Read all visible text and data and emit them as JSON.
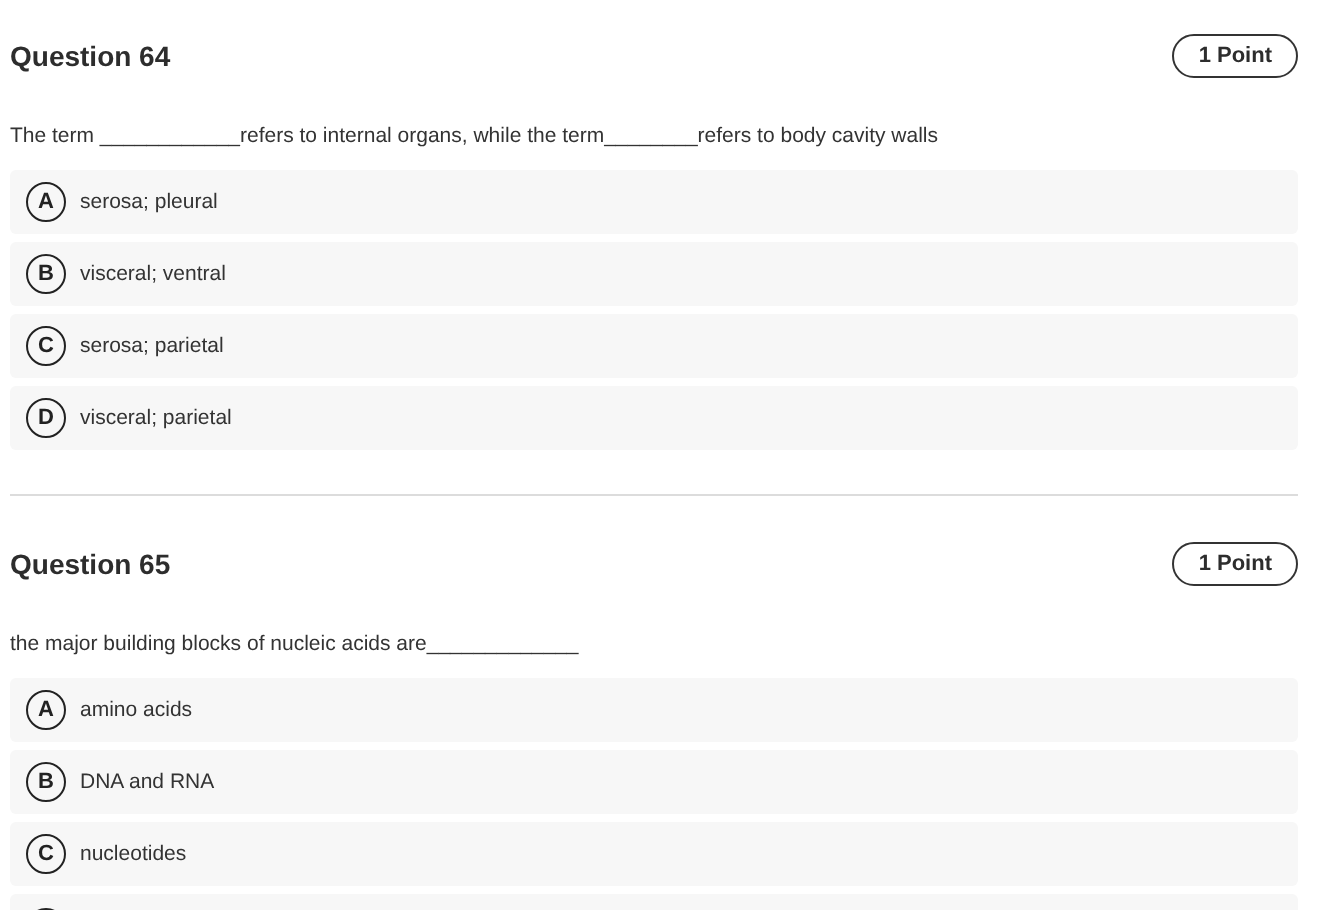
{
  "questions": [
    {
      "title": "Question 64",
      "points": "1 Point",
      "text": "The term ____________refers to internal organs, while the term________refers to body cavity walls",
      "options": [
        {
          "letter": "A",
          "text": "serosa; pleural"
        },
        {
          "letter": "B",
          "text": "visceral; ventral"
        },
        {
          "letter": "C",
          "text": "serosa; parietal"
        },
        {
          "letter": "D",
          "text": "visceral; parietal"
        }
      ],
      "more_below": false
    },
    {
      "title": "Question 65",
      "points": "1 Point",
      "text": "the major building blocks of nucleic acids are_____________",
      "options": [
        {
          "letter": "A",
          "text": "amino acids"
        },
        {
          "letter": "B",
          "text": "DNA and RNA"
        },
        {
          "letter": "C",
          "text": "nucleotides"
        }
      ],
      "more_below": true
    }
  ]
}
